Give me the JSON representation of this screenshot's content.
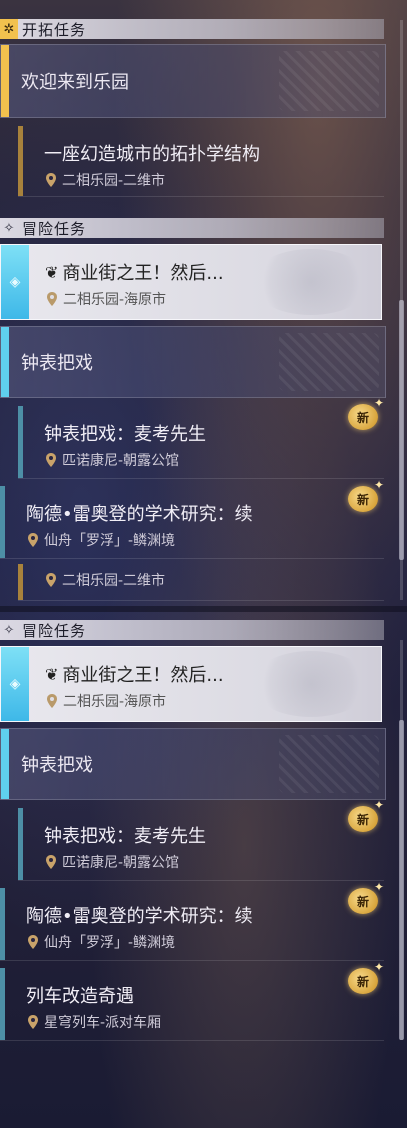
{
  "panel_a": {
    "trailblaze_header": "开拓任务",
    "trailblaze_category": "欢迎来到乐园",
    "trailblaze_quest": {
      "title": "一座幻造城市的拓扑学结构",
      "location": "二相乐园-二维市"
    },
    "adventure_header": "冒险任务",
    "selected_quest": {
      "title": "商业街之王！然后...",
      "location": "二相乐园-海原市"
    },
    "clock_category": "钟表把戏",
    "quests": [
      {
        "title": "钟表把戏：麦考先生",
        "location": "匹诺康尼-朝露公馆",
        "badge": "新"
      },
      {
        "title": "陶德•雷奥登的学术研究：续",
        "location": "仙舟「罗浮」-鳞渊境",
        "badge": "新"
      }
    ],
    "partial_quest_location": "二相乐园-二维市"
  },
  "panel_b": {
    "adventure_header": "冒险任务",
    "selected_quest": {
      "title": "商业街之王！然后...",
      "location": "二相乐园-海原市"
    },
    "clock_category": "钟表把戏",
    "quests": [
      {
        "title": "钟表把戏：麦考先生",
        "location": "匹诺康尼-朝露公馆",
        "badge": "新"
      },
      {
        "title": "陶德•雷奥登的学术研究：续",
        "location": "仙舟「罗浮」-鳞渊境",
        "badge": "新"
      },
      {
        "title": "列车改造奇遇",
        "location": "星穹列车-派对车厢",
        "badge": "新"
      }
    ]
  },
  "colors": {
    "gold_accent": "#f2c14e",
    "cyan_accent": "#5fd0ee",
    "quest_bar_gold": "#a8823c",
    "quest_bar_teal": "#4d8fa6"
  },
  "icons": {
    "trailblaze": "star-compass-icon",
    "adventure": "diamond-icon",
    "location": "map-pin-icon",
    "new": "new-badge-icon"
  }
}
